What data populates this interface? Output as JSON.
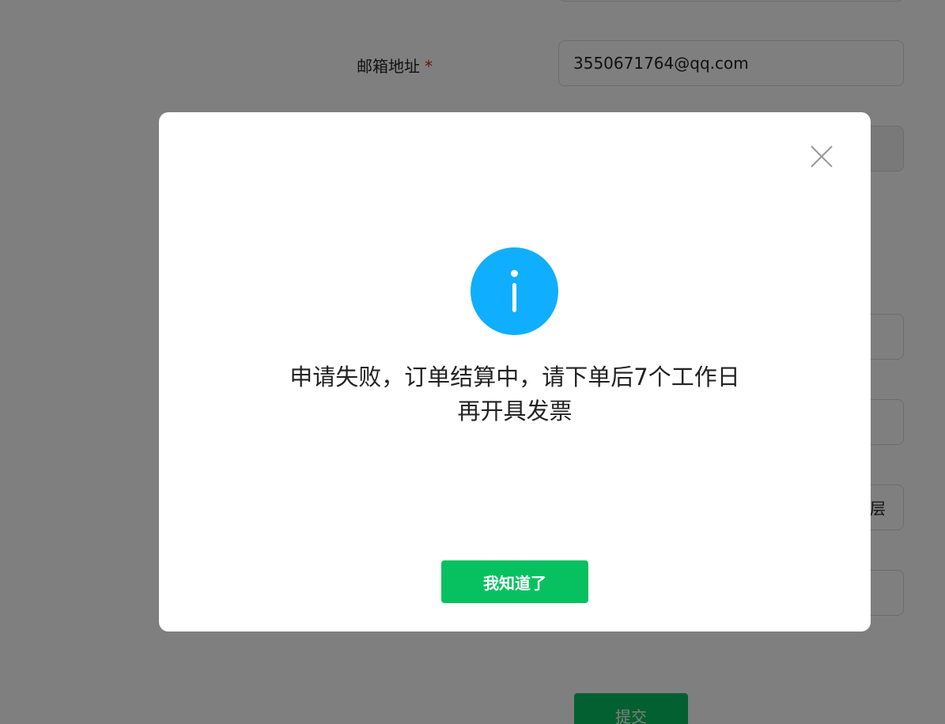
{
  "form": {
    "email_label": "邮箱地址",
    "required_mark": "*",
    "email_value": "3550671764@qq.com",
    "address_tail": "层",
    "submit_label": "提交"
  },
  "dialog": {
    "icon": "info-icon",
    "close_icon": "close-icon",
    "message": "申请失败，订单结算中，请下单后7个工作日再开具发票",
    "confirm_label": "我知道了"
  },
  "colors": {
    "accent_green": "#07c160",
    "info_blue": "#10aeff",
    "overlay": "rgba(0,0,0,0.5)"
  }
}
